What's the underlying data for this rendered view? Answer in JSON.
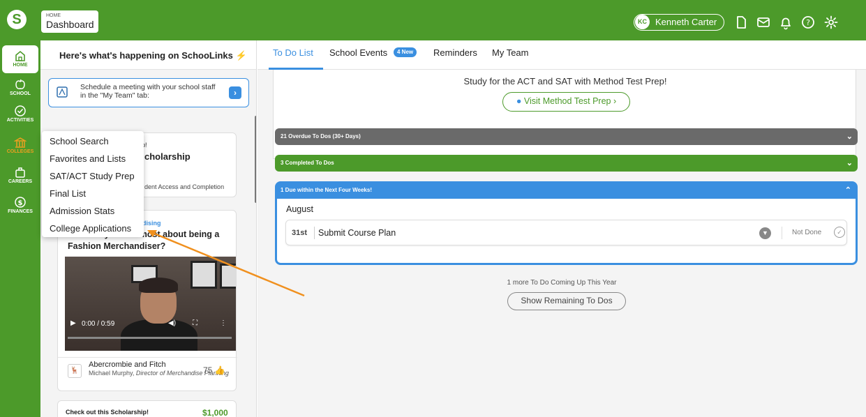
{
  "topbar": {
    "logo": "S",
    "breadcrumb_small": "HOME",
    "breadcrumb_title": "Dashboard",
    "user_initials": "KC",
    "user_name": "Kenneth Carter",
    "icons": [
      "document-icon",
      "mail-icon",
      "bell-icon",
      "help-icon",
      "gear-icon"
    ]
  },
  "rail": {
    "items": [
      {
        "label": "HOME",
        "icon": "home-icon"
      },
      {
        "label": "SCHOOL",
        "icon": "apple-icon"
      },
      {
        "label": "ACTIVITIES",
        "icon": "check-circle-icon"
      },
      {
        "label": "COLLEGES",
        "icon": "college-icon"
      },
      {
        "label": "CAREERS",
        "icon": "briefcase-icon"
      },
      {
        "label": "FINANCES",
        "icon": "money-icon"
      }
    ]
  },
  "left_panel": {
    "header": "Here's what's happening on SchooLinks",
    "header_icon": "⚡",
    "meeting_text": "Schedule a meeting with your school staff in the \"My Team\" tab:",
    "card1_small": "p!",
    "card1_title": "cholarship",
    "card1_footer": "dent Access and Completion",
    "card2_tag": "dising",
    "card2_title": "What do you like most about being a Fashion Merchandiser?",
    "video_time": "0:00 / 0:59",
    "company": "Abercrombie and Fitch",
    "person": "Michael Murphy,",
    "person_title": "Director of Merchandise Planning",
    "likes": "75",
    "card3_title": "Check out this Scholarship!",
    "card3_amount": "$1,000"
  },
  "menu": {
    "items": [
      "School Search",
      "Favorites and Lists",
      "SAT/ACT Study Prep",
      "Final List",
      "Admission Stats",
      "College Applications"
    ]
  },
  "tabs": {
    "todo": "To Do List",
    "events": "School Events",
    "events_badge": "4 New",
    "reminders": "Reminders",
    "team": "My Team"
  },
  "promo": {
    "text": "Study for the ACT and SAT with Method Test Prep!",
    "button": "Visit Method Test Prep"
  },
  "sections": {
    "overdue": "21 Overdue To Dos (30+ Days)",
    "completed": "3 Completed To Dos",
    "due": "1 Due within the Next Four Weeks!"
  },
  "due_list": {
    "month": "August",
    "day": "31st",
    "task": "Submit Course Plan",
    "status": "Not Done"
  },
  "footer": {
    "more_text": "1 more To Do Coming Up This Year",
    "remain_button": "Show Remaining To Dos"
  },
  "colors": {
    "brand_green": "#4c9a2a",
    "accent_blue": "#3a8fe0",
    "overdue_gray": "#6a6a6a",
    "annotation_orange": "#f0901e"
  }
}
